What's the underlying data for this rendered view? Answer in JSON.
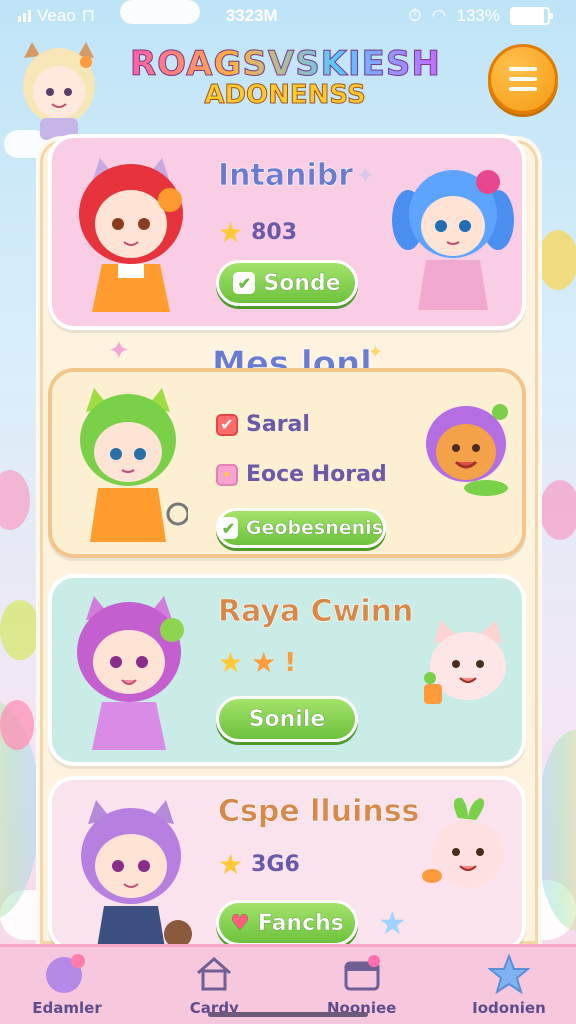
{
  "status_bar": {
    "carrier": "Veao",
    "time": "3323M",
    "battery_text": "133%",
    "battery_level": 0.9
  },
  "header": {
    "logo_line1": "ROAGSVSKIESH",
    "logo_line2": "ADONENSS",
    "menu_icon": "hamburger-icon",
    "accent": "#f59a12"
  },
  "cards": [
    {
      "title": "Intanibr",
      "stat_icon": "star-icon",
      "stat": "803",
      "button_label": "Sonde",
      "bg": "#f9cde3",
      "title_color": "#6a7bd0"
    },
    {
      "title": "Mes lonl",
      "options": [
        {
          "label": "Saral",
          "icon": "checkbox-checked-icon",
          "checked": true
        },
        {
          "label": "Eoce Horad",
          "icon": "checkbox-unchecked-icon",
          "checked": false
        }
      ],
      "button_label": "Geobesnenis",
      "bg": "#fdf0d2",
      "title_color": "#6a7bd0"
    },
    {
      "title": "Raya Cwinn",
      "stat_icons": [
        "star-icon",
        "star-icon",
        "exclamation-icon"
      ],
      "button_label": "Sonile",
      "bg": "#c9ece7",
      "title_color": "#d6894a"
    },
    {
      "title": "Cspe lluinss",
      "stat_icon": "star-icon",
      "stat": "3G6",
      "button_label": "Fanchs",
      "bg": "#fbe3ee",
      "title_color": "#d6894a"
    }
  ],
  "bottom_nav": [
    {
      "label": "Edamler",
      "icon": "balloon-icon"
    },
    {
      "label": "Cardy",
      "icon": "home-icon"
    },
    {
      "label": "Nooniee",
      "icon": "calendar-icon"
    },
    {
      "label": "Iodonien",
      "icon": "star-icon"
    }
  ]
}
